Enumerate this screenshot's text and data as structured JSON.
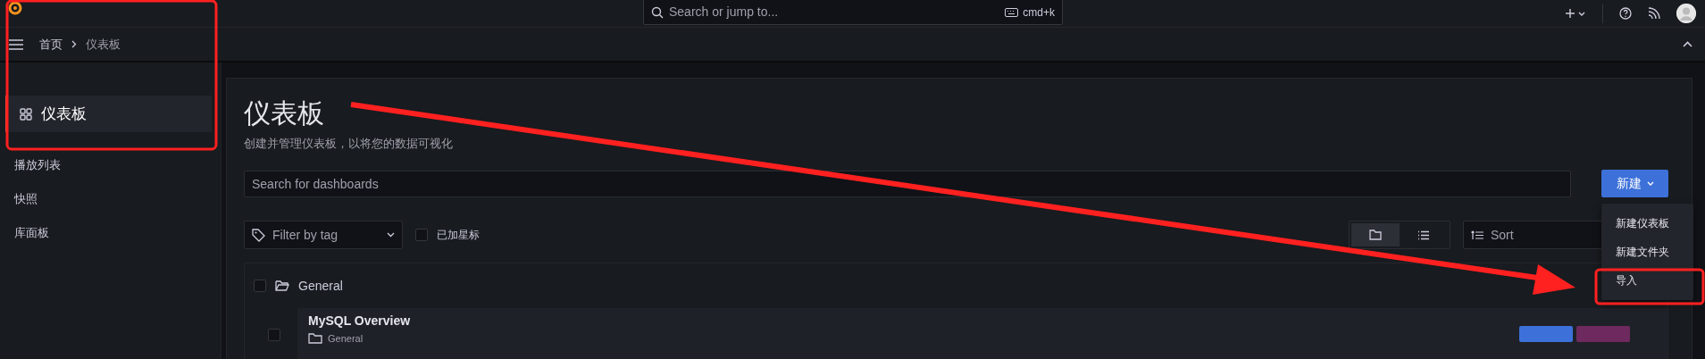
{
  "top_bar": {
    "search": {
      "placeholder": "Search or jump to...",
      "shortcut": "cmd+k"
    }
  },
  "breadcrumb": [
    "首页",
    "仪表板"
  ],
  "sidebar": {
    "items": [
      {
        "label": "仪表板",
        "selected": true,
        "kind": "icon"
      },
      {
        "label": "播放列表",
        "selected": false,
        "kind": "plain"
      },
      {
        "label": "快照",
        "selected": false,
        "kind": "plain"
      },
      {
        "label": "库面板",
        "selected": false,
        "kind": "plain"
      }
    ]
  },
  "page": {
    "title": "仪表板",
    "subtitle": "创建并管理仪表板，以将您的数据可视化"
  },
  "search": {
    "placeholder": "Search for dashboards"
  },
  "new_button": {
    "label": "新建",
    "menu": [
      "新建仪表板",
      "新建文件夹",
      "导入"
    ]
  },
  "filters": {
    "tag_filter": {
      "placeholder": "Filter by tag"
    },
    "starred": {
      "label": "已加星标",
      "checked": false
    }
  },
  "view_toggle": [
    {
      "kind": "folder",
      "selected": true
    },
    {
      "kind": "list",
      "selected": false
    }
  ],
  "sort": {
    "placeholder": "Sort"
  },
  "folders": [
    {
      "name": "General",
      "checked": false,
      "expanded": true,
      "dashboards": [
        {
          "title": "MySQL Overview",
          "folder": "General",
          "checked": false,
          "tags": [
            {
              "color": "#3d71d9"
            },
            {
              "color": "#6e2a5e"
            }
          ]
        }
      ]
    }
  ]
}
